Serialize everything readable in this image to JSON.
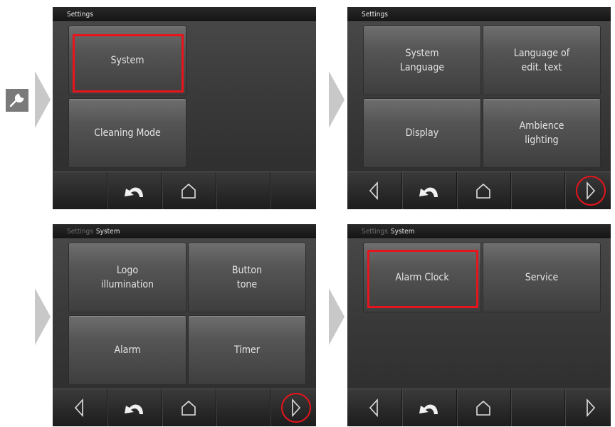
{
  "colors": {
    "highlight": "#e8141c",
    "button_text": "#e4e4e4",
    "arrow": "#c8c8c8"
  },
  "icons": [
    "wrench-icon",
    "arrow-right-icon",
    "back-icon",
    "home-icon",
    "prev-page-icon",
    "next-page-icon"
  ],
  "screen1": {
    "crumb_active": "Settings",
    "buttons": [
      "System",
      "Cleaning Mode"
    ]
  },
  "screen2": {
    "crumb_active": "Settings",
    "buttons": [
      "System\nLanguage",
      "Language of\nedit. text",
      "Display",
      "Ambience\nlighting"
    ]
  },
  "screen3": {
    "crumb_parent": "Settings",
    "crumb_active": "System",
    "buttons": [
      "Logo\nillumination",
      "Button\ntone",
      "Alarm",
      "Timer"
    ]
  },
  "screen4": {
    "crumb_parent": "Settings",
    "crumb_active": "System",
    "buttons": [
      "Alarm Clock",
      "Service"
    ]
  }
}
